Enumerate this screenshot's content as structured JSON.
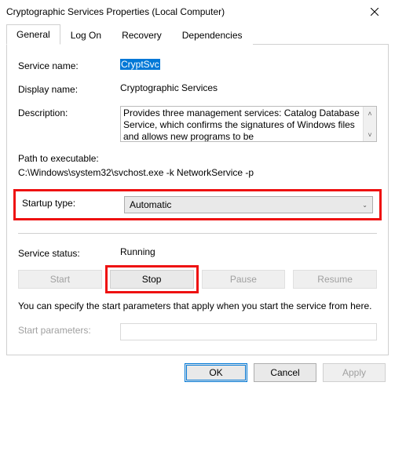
{
  "window": {
    "title": "Cryptographic Services Properties (Local Computer)"
  },
  "tabs": {
    "items": [
      {
        "label": "General"
      },
      {
        "label": "Log On"
      },
      {
        "label": "Recovery"
      },
      {
        "label": "Dependencies"
      }
    ]
  },
  "general": {
    "service_name_label": "Service name:",
    "service_name_value": "CryptSvc",
    "display_name_label": "Display name:",
    "display_name_value": "Cryptographic Services",
    "description_label": "Description:",
    "description_value": "Provides three management services: Catalog Database Service, which confirms the signatures of Windows files and allows new programs to be",
    "path_label": "Path to executable:",
    "path_value": "C:\\Windows\\system32\\svchost.exe -k NetworkService -p",
    "startup_type_label": "Startup type:",
    "startup_type_value": "Automatic",
    "status_label": "Service status:",
    "status_value": "Running",
    "buttons": {
      "start": "Start",
      "stop": "Stop",
      "pause": "Pause",
      "resume": "Resume"
    },
    "hint": "You can specify the start parameters that apply when you start the service from here.",
    "start_params_label": "Start parameters:",
    "start_params_value": ""
  },
  "footer": {
    "ok": "OK",
    "cancel": "Cancel",
    "apply": "Apply"
  }
}
